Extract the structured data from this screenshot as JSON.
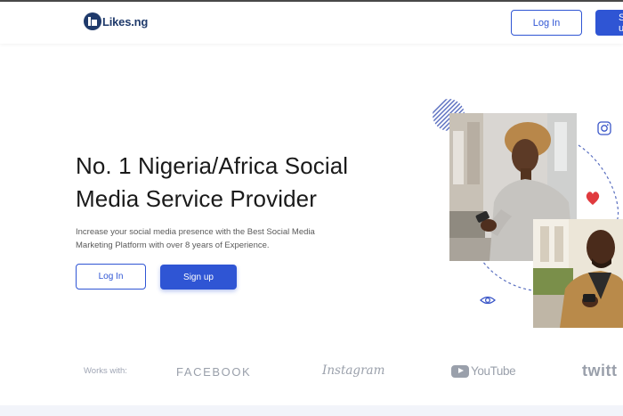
{
  "header": {
    "logo_text": "Likes.ng",
    "login_label": "Log In",
    "signup_label": "Sign up"
  },
  "hero": {
    "title": "No. 1 Nigeria/Africa Social Media Service Provider",
    "subtitle": "Increase your social media presence with the Best Social Media Marketing Platform with over 8 years of Experience.",
    "login_label": "Log In",
    "signup_label": "Sign up"
  },
  "partners": {
    "label": "Works with:",
    "facebook": "FACEBOOK",
    "instagram": "Instagram",
    "youtube": "YouTube",
    "twitter": "twitt"
  },
  "colors": {
    "accent": "#2f55d4",
    "brand_navy": "#1f3a6b",
    "heart": "#e03a3e",
    "muted_logo": "#9aa0ab"
  },
  "icons": [
    "instagram-icon",
    "heart-icon",
    "eye-icon",
    "youtube-play-icon"
  ]
}
